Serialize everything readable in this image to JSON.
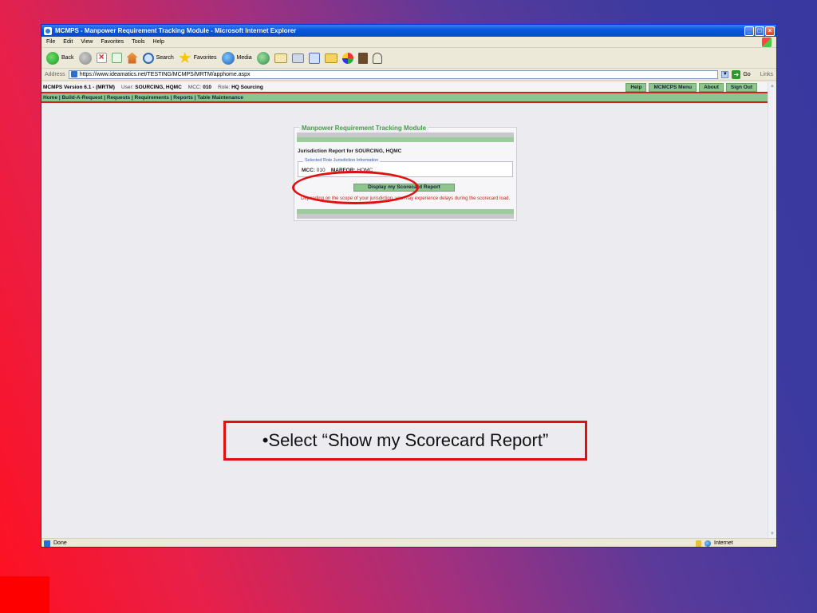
{
  "window": {
    "title": "MCMPS - Manpower Requirement Tracking Module - Microsoft Internet Explorer",
    "buttons": {
      "minimize": "_",
      "maximize": "□",
      "close": "×"
    }
  },
  "menubar": {
    "items": [
      "File",
      "Edit",
      "View",
      "Favorites",
      "Tools",
      "Help"
    ]
  },
  "toolbar": {
    "back_label": "Back",
    "search_label": "Search",
    "favorites_label": "Favorites",
    "media_label": "Media"
  },
  "address": {
    "label": "Address",
    "url": "https://www.ideamatics.net/TESTING/MCMPS/MRTM/apphome.aspx",
    "go_label": "Go",
    "links_label": "Links"
  },
  "appbar": {
    "version": "MCMPS Version 6.1 - (MRTM)",
    "user_label": "User:",
    "user": "SOURCING, HQMC",
    "mcc_label": "MCC:",
    "mcc": "010",
    "role_label": "Role:",
    "role": "HQ Sourcing",
    "menu": [
      "Help",
      "MCMCPS Menu",
      "About",
      "Sign Out"
    ]
  },
  "navbar": {
    "text": "Home | Build-A-Request | Requests | Requirements | Reports | Table Maintenance"
  },
  "module": {
    "title": "Manpower Requirement Tracking Module",
    "jurisdiction_title": "Jurisdiction Report for SOURCING, HQMC",
    "legend": "Selected Role Jurisdiction Information",
    "mcc_label": "MCC:",
    "mcc": "010",
    "marfor_label": "MARFOR:",
    "marfor": "HQMC",
    "display_button": "Display my Scorecard Report",
    "warning": "Depending on the scope of your jurisdiction, you may experience delays during the scorecard load."
  },
  "status": {
    "left": "Done",
    "zone": "Internet"
  },
  "caption": "•Select “Show my Scorecard Report”"
}
